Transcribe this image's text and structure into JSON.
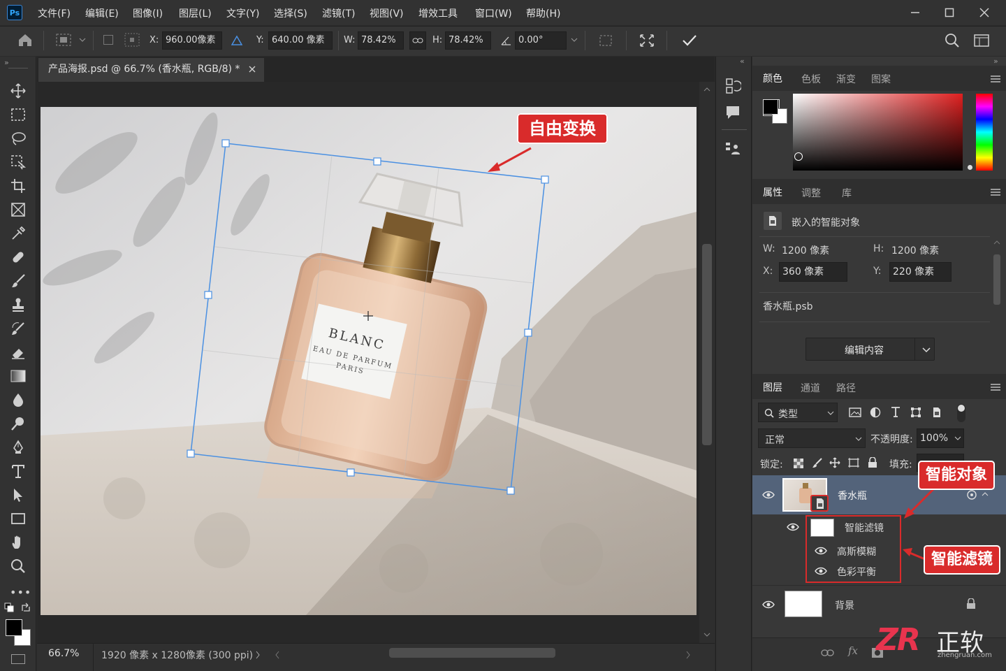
{
  "app": {
    "logo": "Ps"
  },
  "menu": [
    "文件(F)",
    "编辑(E)",
    "图像(I)",
    "图层(L)",
    "文字(Y)",
    "选择(S)",
    "滤镜(T)",
    "视图(V)",
    "增效工具",
    "窗口(W)",
    "帮助(H)"
  ],
  "options": {
    "x_label": "X:",
    "x_value": "960.00像素",
    "y_label": "Y:",
    "y_value": "640.00 像素",
    "w_label": "W:",
    "w_value": "78.42%",
    "h_label": "H:",
    "h_value": "78.42%",
    "angle_value": "0.00°"
  },
  "document": {
    "tab_title": "产品海报.psd @ 66.7% (香水瓶, RGB/8) *",
    "zoom": "66.7%",
    "info": "1920 像素 x 1280像素 (300 ppi)",
    "label_line1": "BLANC",
    "label_line2": "EAU DE PARFUM",
    "label_line3": "PARIS"
  },
  "color_panel": {
    "tabs": [
      "颜色",
      "色板",
      "渐变",
      "图案"
    ],
    "active": 0
  },
  "properties_panel": {
    "tabs": [
      "属性",
      "调整",
      "库"
    ],
    "active": 0,
    "object_type": "嵌入的智能对象",
    "w_label": "W:",
    "w_value": "1200 像素",
    "h_label": "H:",
    "h_value": "1200 像素",
    "x_label": "X:",
    "x_value": "360 像素",
    "y_label": "Y:",
    "y_value": "220 像素",
    "file": "香水瓶.psb",
    "edit_button": "编辑内容"
  },
  "layers_panel": {
    "tabs": [
      "图层",
      "通道",
      "路径"
    ],
    "active": 0,
    "filter_kind": "类型",
    "blend_mode": "正常",
    "opacity_label": "不透明度:",
    "opacity_value": "100%",
    "lock_label": "锁定:",
    "fill_label": "填充:",
    "layers": [
      {
        "name": "香水瓶",
        "selected": true
      },
      {
        "name": "智能滤镜"
      },
      {
        "name": "高斯模糊"
      },
      {
        "name": "色彩平衡"
      },
      {
        "name": "背景"
      }
    ]
  },
  "annotations": {
    "free_transform": "自由变换",
    "smart_object": "智能对象",
    "smart_filters": "智能滤镜"
  },
  "watermark": {
    "brand": "ZR",
    "text": "正软",
    "url": "zhengruan.com"
  },
  "colors": {
    "accent": "#d92b2b",
    "selection": "#4a90e2",
    "selected_layer": "#53637a"
  }
}
